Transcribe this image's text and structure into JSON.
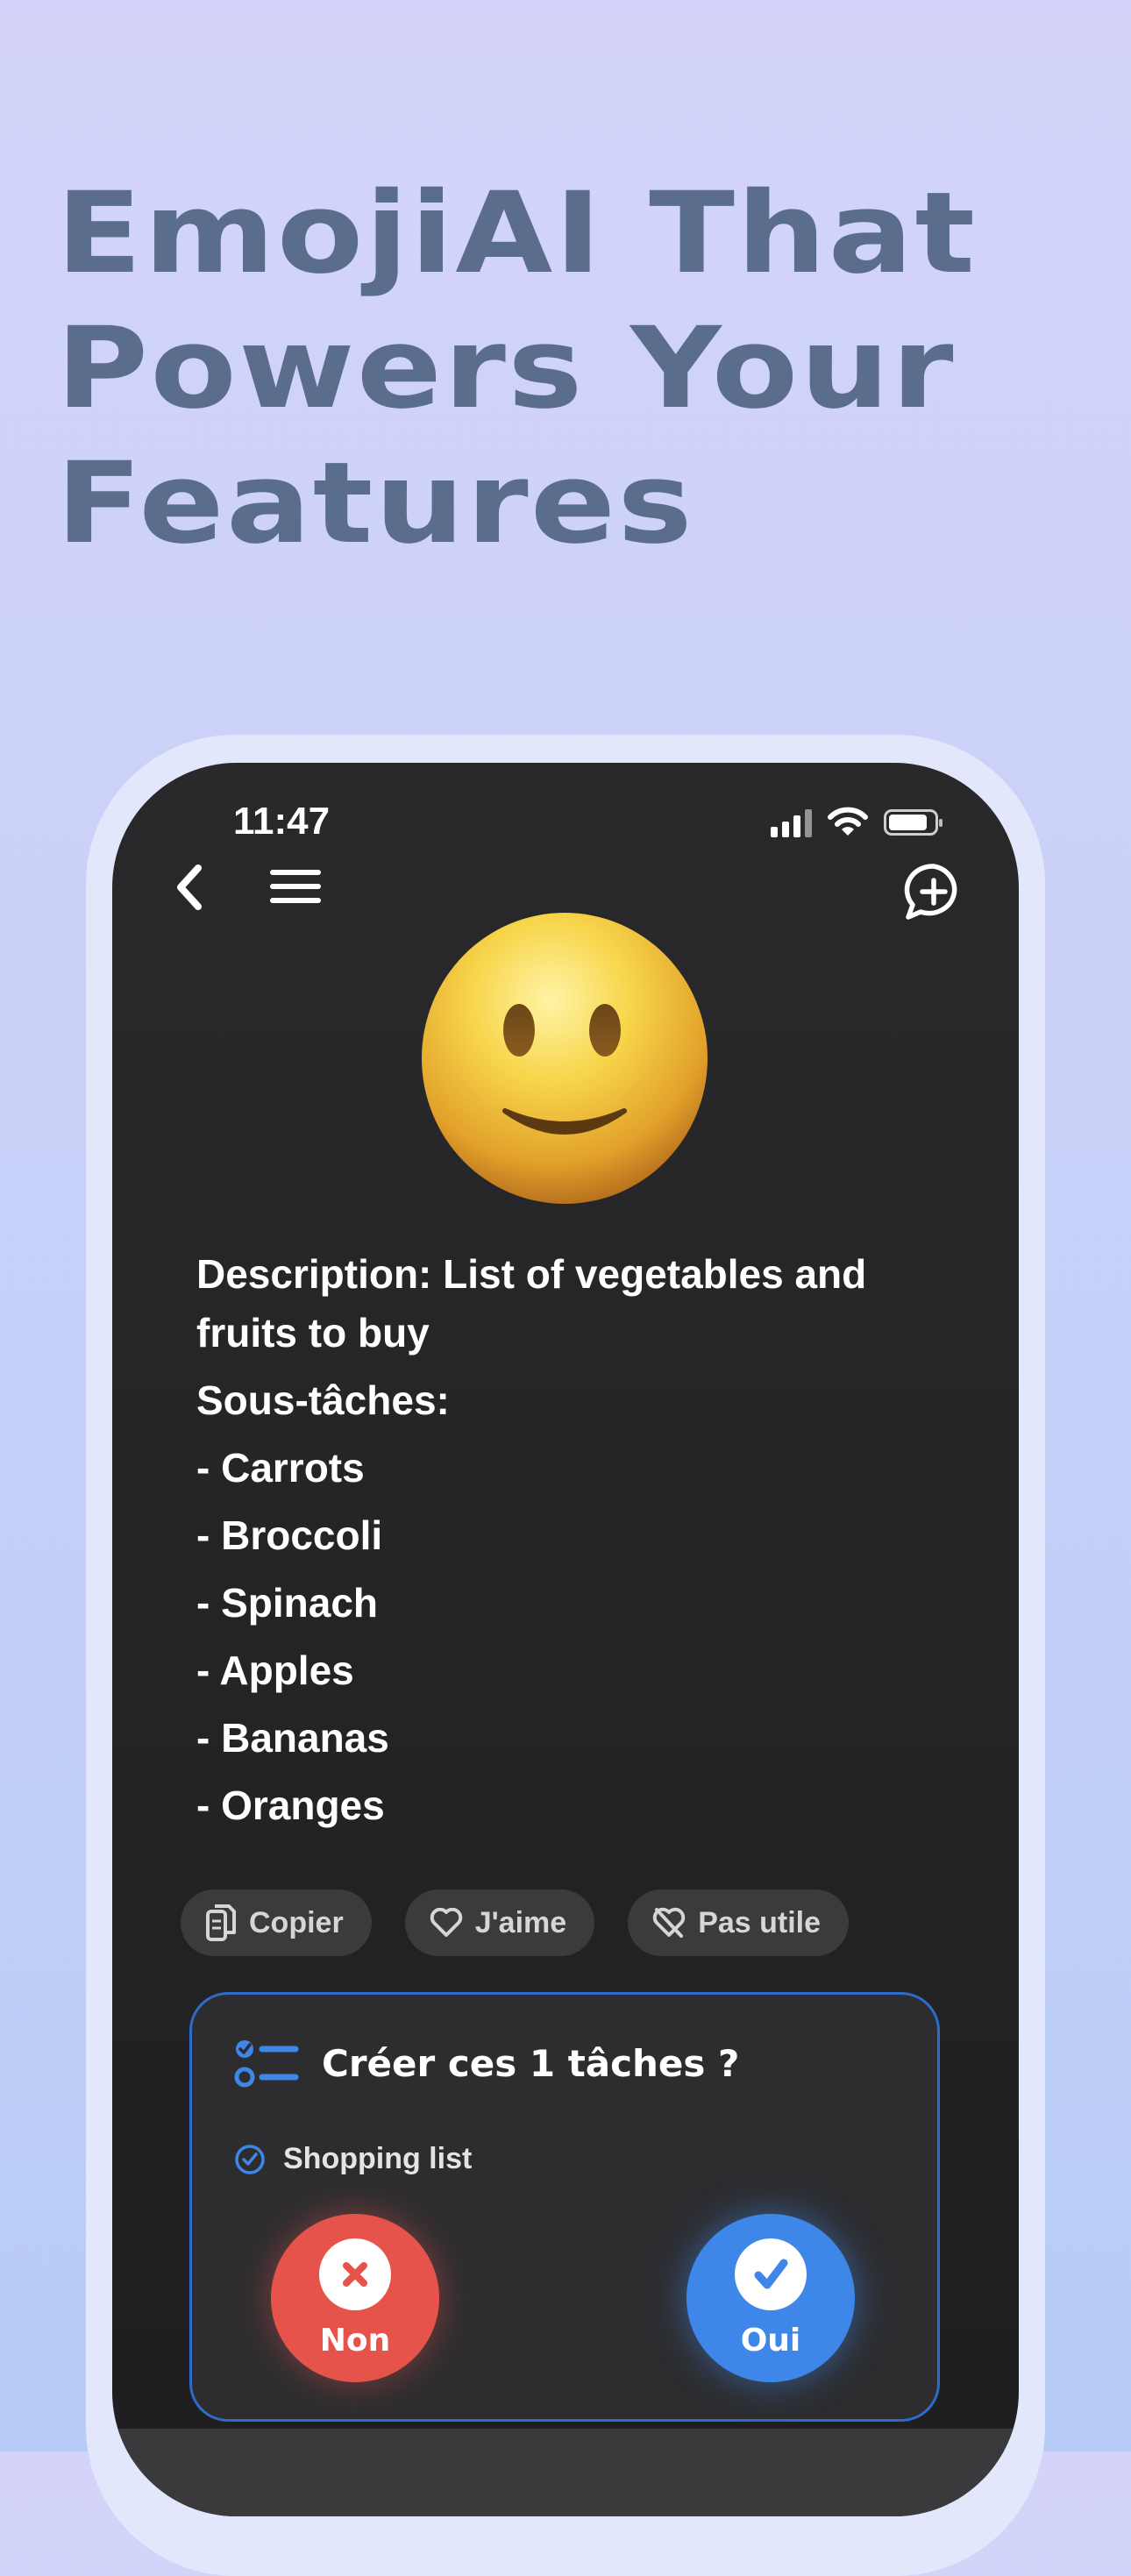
{
  "headline": {
    "line1": "EmojiAI That",
    "line2": "Powers Your",
    "line3": "Features"
  },
  "status_bar": {
    "time": "11:47"
  },
  "colors": {
    "background_top": "#d4d4fa",
    "headline": "#5b6d8d",
    "screen": "#262628",
    "accent_blue": "#3e86e8",
    "accent_red": "#e5534b"
  },
  "nav": {
    "back_icon": "chevron-left-icon",
    "menu_icon": "hamburger-menu-icon",
    "new_chat_icon": "chat-plus-icon"
  },
  "message": {
    "lines": [
      "Description: List of vegetables and fruits to buy",
      "Sous-tâches:",
      "- Carrots",
      "- Broccoli",
      "- Spinach",
      "- Apples",
      "- Bananas",
      "- Oranges"
    ]
  },
  "actions": {
    "copy_label": "Copier",
    "like_label": "J'aime",
    "not_useful_label": "Pas utile"
  },
  "task_card": {
    "title": "Créer ces 1 tâches ?",
    "tasks": [
      "Shopping list"
    ],
    "no_label": "Non",
    "yes_label": "Oui"
  }
}
